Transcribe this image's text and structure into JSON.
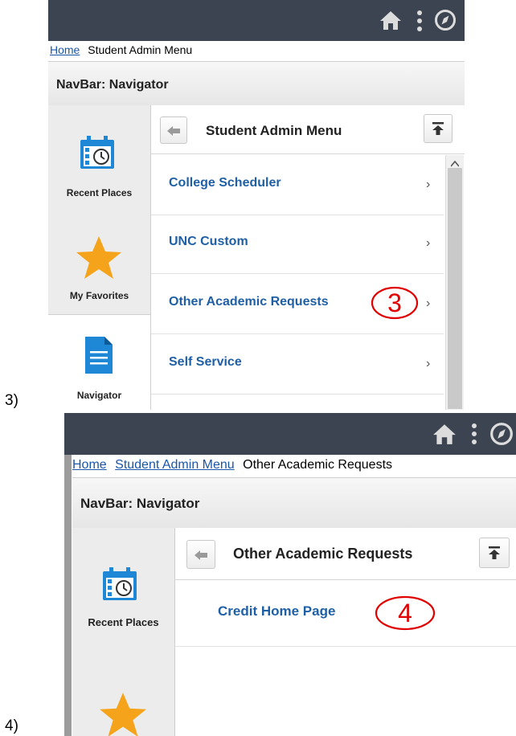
{
  "steps": {
    "first": "3)",
    "second": "4)"
  },
  "screen3": {
    "breadcrumb": {
      "home": "Home",
      "current": "Student Admin Menu"
    },
    "navbar_title": "NavBar: Navigator",
    "tiles": {
      "recent": "Recent Places",
      "favorites": "My Favorites",
      "navigator": "Navigator"
    },
    "menu_title": "Student Admin Menu",
    "items": [
      "College Scheduler",
      "UNC Custom",
      "Other Academic Requests",
      "Self Service"
    ],
    "annotation": "3"
  },
  "screen4": {
    "breadcrumb": {
      "home": "Home",
      "middle": "Student Admin Menu",
      "current": "Other Academic Requests"
    },
    "navbar_title": "NavBar: Navigator",
    "tiles": {
      "recent": "Recent Places"
    },
    "menu_title": "Other Academic Requests",
    "items": [
      "Credit Home Page"
    ],
    "annotation": "4"
  },
  "colors": {
    "topbar": "#3b4450",
    "link": "#1f5fa6",
    "annotation": "#e00000",
    "star": "#f5a31a",
    "calendar": "#1e88d6"
  },
  "icons": [
    "home-icon",
    "kebab-menu-icon",
    "compass-icon",
    "calendar-clock-icon",
    "star-icon",
    "document-icon",
    "back-arrow-icon",
    "scroll-top-icon",
    "chevron-right-icon"
  ]
}
